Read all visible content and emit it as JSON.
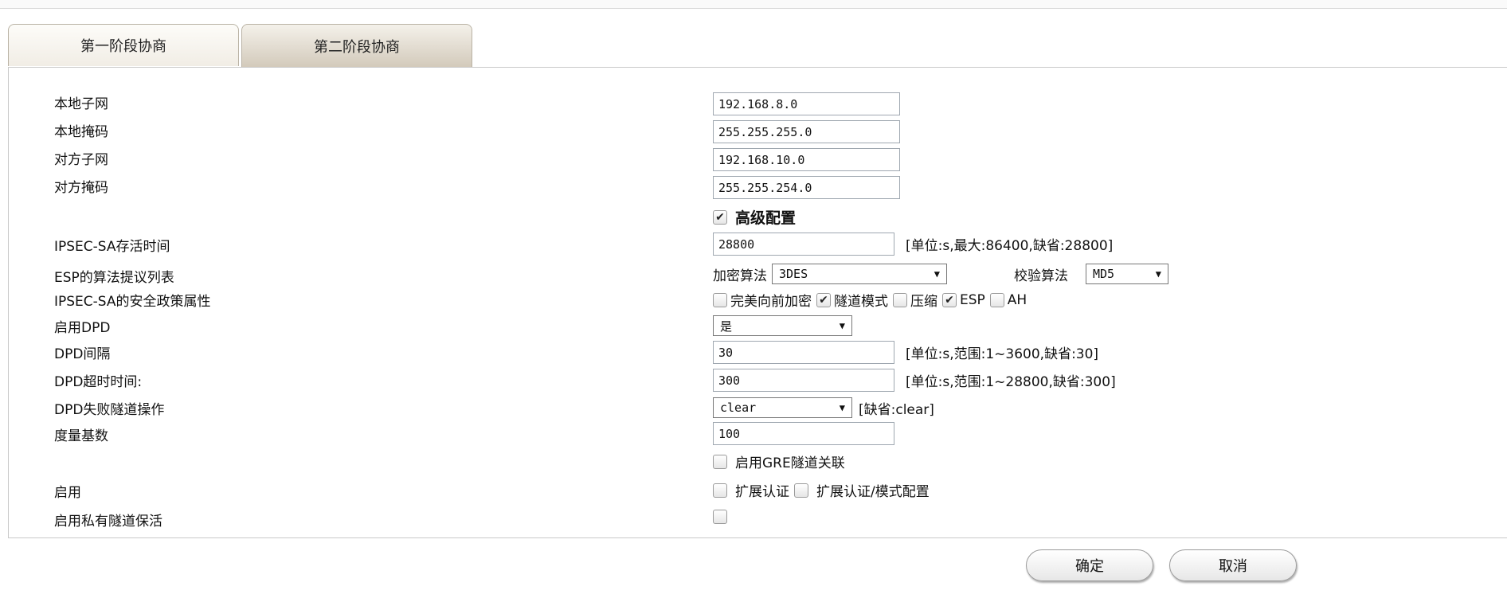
{
  "tabs": [
    "第一阶段协商",
    "第二阶段协商"
  ],
  "form": {
    "local_subnet": {
      "label": "本地子网",
      "value": "192.168.8.0"
    },
    "local_mask": {
      "label": "本地掩码",
      "value": "255.255.255.0"
    },
    "remote_subnet": {
      "label": "对方子网",
      "value": "192.168.10.0"
    },
    "remote_mask": {
      "label": "对方掩码",
      "value": "255.255.254.0"
    },
    "advanced": {
      "label": "高级配置",
      "checked": true
    },
    "sa_lifetime": {
      "label": "IPSEC-SA存活时间",
      "value": "28800",
      "note": "[单位:s,最大:86400,缺省:28800]"
    },
    "esp_proposal": {
      "label": "ESP的算法提议列表",
      "enc_label": "加密算法",
      "enc_value": "3DES",
      "auth_label": "校验算法",
      "auth_value": "MD5"
    },
    "sa_policy": {
      "label": "IPSEC-SA的安全政策属性",
      "options": [
        {
          "label": "完美向前加密",
          "checked": false
        },
        {
          "label": "隧道模式",
          "checked": true
        },
        {
          "label": "压缩",
          "checked": false
        },
        {
          "label": "ESP",
          "checked": true
        },
        {
          "label": "AH",
          "checked": false
        }
      ]
    },
    "enable_dpd": {
      "label": "启用DPD",
      "value": "是"
    },
    "dpd_interval": {
      "label": "DPD间隔",
      "value": "30",
      "note": "[单位:s,范围:1~3600,缺省:30]"
    },
    "dpd_timeout": {
      "label": "DPD超时时间:",
      "value": "300",
      "note": "[单位:s,范围:1~28800,缺省:300]"
    },
    "dpd_fail_action": {
      "label": "DPD失败隧道操作",
      "value": "clear",
      "note": "[缺省:clear]"
    },
    "metric": {
      "label": "度量基数",
      "value": "100"
    },
    "gre_link": {
      "label": "启用GRE隧道关联",
      "checked": false
    },
    "enable": {
      "label": "启用",
      "ext_auth": "扩展认证",
      "ext_auth_mode": "扩展认证/模式配置"
    },
    "private_keepalive": {
      "label": "启用私有隧道保活"
    }
  },
  "buttons": {
    "ok": "确定",
    "cancel": "取消"
  }
}
